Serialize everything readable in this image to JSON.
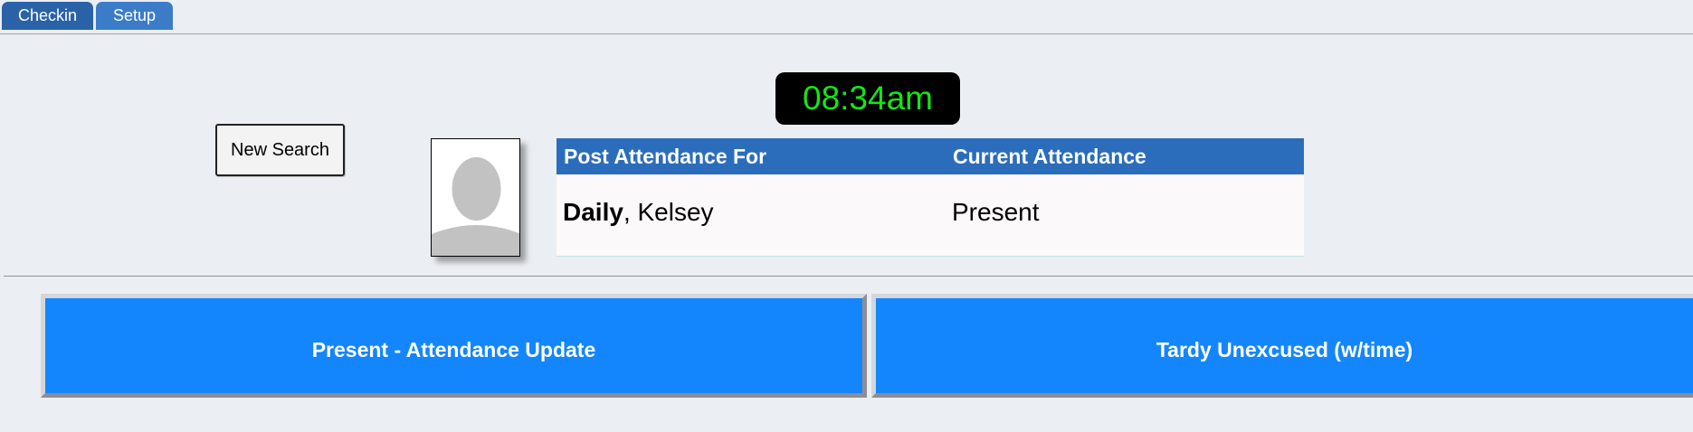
{
  "tabs": [
    {
      "label": "Checkin"
    },
    {
      "label": "Setup"
    }
  ],
  "clock": {
    "time": "08:34am"
  },
  "search": {
    "new_search_label": "New Search"
  },
  "attendance": {
    "headers": {
      "post_for": "Post Attendance For",
      "current": "Current Attendance"
    },
    "student": {
      "last_name": "Daily",
      "name_separator": ", ",
      "first_name": "Kelsey"
    },
    "current_status": "Present"
  },
  "actions": {
    "present_label": "Present - Attendance Update",
    "tardy_label": "Tardy Unexcused (w/time)"
  },
  "colors": {
    "tab_blue": "#2f6db6",
    "table_header_blue": "#2b6dbb",
    "action_blue": "#1386fd",
    "clock_green": "#14e614"
  },
  "icons": {
    "photo": "person-placeholder-icon"
  }
}
